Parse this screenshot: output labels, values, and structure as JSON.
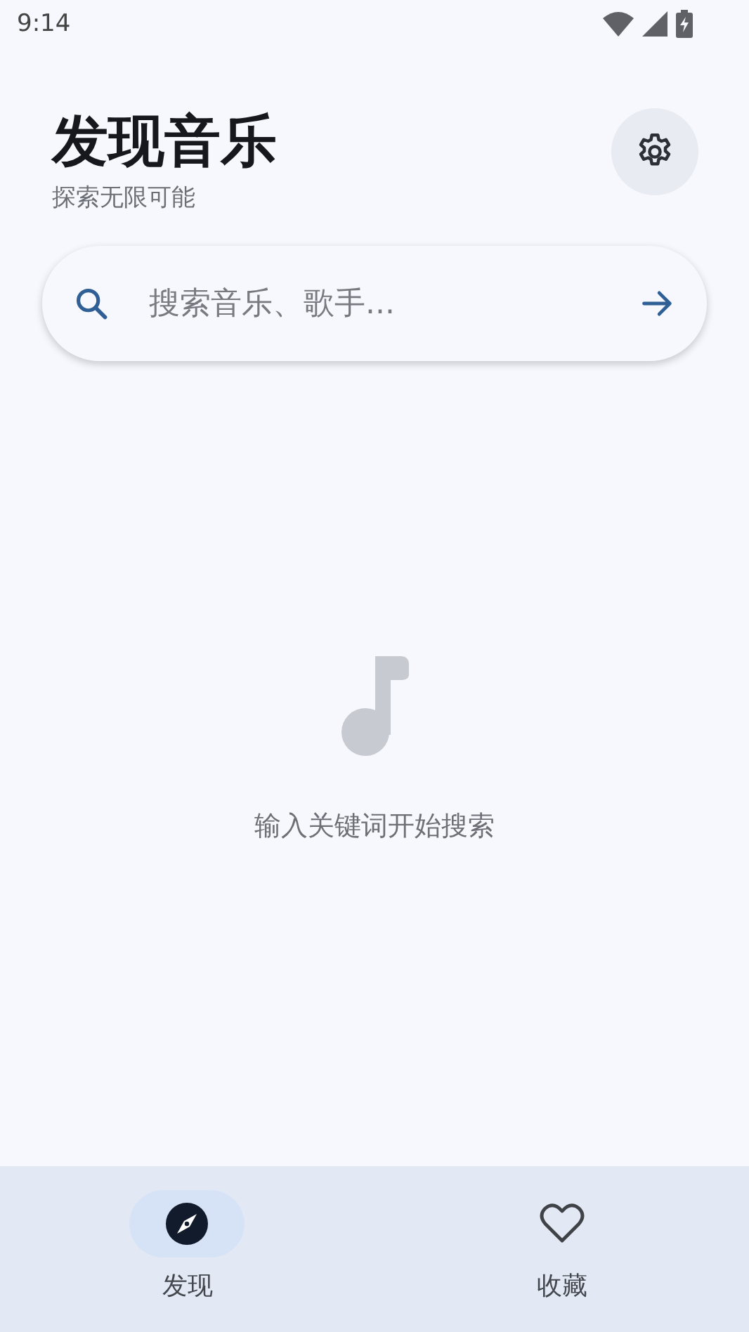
{
  "status_bar": {
    "time": "9:14"
  },
  "header": {
    "title": "发现音乐",
    "subtitle": "探索无限可能"
  },
  "search": {
    "placeholder": "搜索音乐、歌手..."
  },
  "empty_state": {
    "message": "输入关键词开始搜索"
  },
  "bottom_nav": [
    {
      "label": "发现",
      "kind": "compass",
      "selected": true
    },
    {
      "label": "收藏",
      "kind": "heart",
      "selected": false
    }
  ]
}
